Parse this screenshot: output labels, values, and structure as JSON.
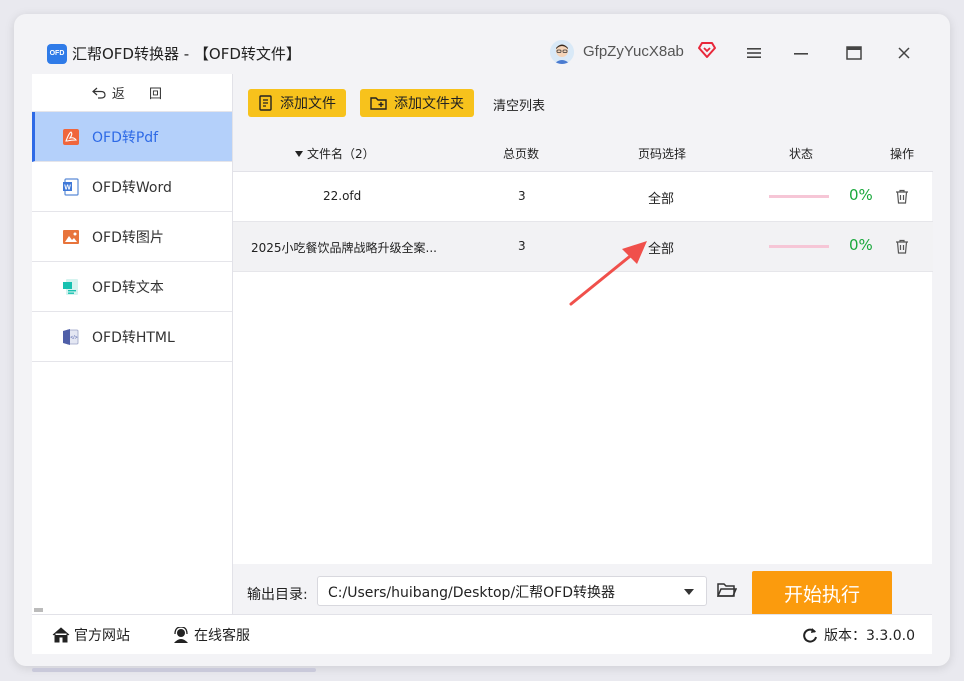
{
  "window": {
    "logo_text": "OFD",
    "title": "汇帮OFD转换器 - 【OFD转文件】",
    "username": "GfpZyYucX8ab"
  },
  "icons": {
    "menu": "hamburger-icon",
    "minimize": "minimize-icon",
    "maximize": "maximize-icon",
    "close": "close-icon",
    "vip": "heart-diamond-icon"
  },
  "sidebar": {
    "back_label": "返 回",
    "items": [
      {
        "label": "OFD转Pdf",
        "icon": "pdf-icon",
        "active": true
      },
      {
        "label": "OFD转Word",
        "icon": "word-icon"
      },
      {
        "label": "OFD转图片",
        "icon": "image-icon"
      },
      {
        "label": "OFD转文本",
        "icon": "text-icon"
      },
      {
        "label": "OFD转HTML",
        "icon": "html-icon"
      }
    ]
  },
  "toolbar": {
    "add_file": "添加文件",
    "add_folder": "添加文件夹",
    "clear": "清空列表"
  },
  "table": {
    "headers": {
      "name": "文件名（2）",
      "pages": "总页数",
      "range": "页码选择",
      "status": "状态",
      "action": "操作"
    },
    "rows": [
      {
        "name": "22.ofd",
        "pages": "3",
        "range": "全部",
        "progress": 0,
        "percent": "0%"
      },
      {
        "name": "2025小吃餐饮品牌战略升级全案...",
        "pages": "3",
        "range": "全部",
        "progress": 0,
        "percent": "0%"
      }
    ]
  },
  "output": {
    "label": "输出目录:",
    "path": "C:/Users/huibang/Desktop/汇帮OFD转换器",
    "start": "开始执行"
  },
  "footer": {
    "website": "官方网站",
    "support": "在线客服",
    "version": "版本：3.3.0.0"
  },
  "colors": {
    "accent": "#2e6ae6",
    "button_yellow": "#f7c21c",
    "start_orange": "#fb9b0d",
    "success_green": "#1aa83c",
    "annotation_arrow": "#f0504b"
  }
}
